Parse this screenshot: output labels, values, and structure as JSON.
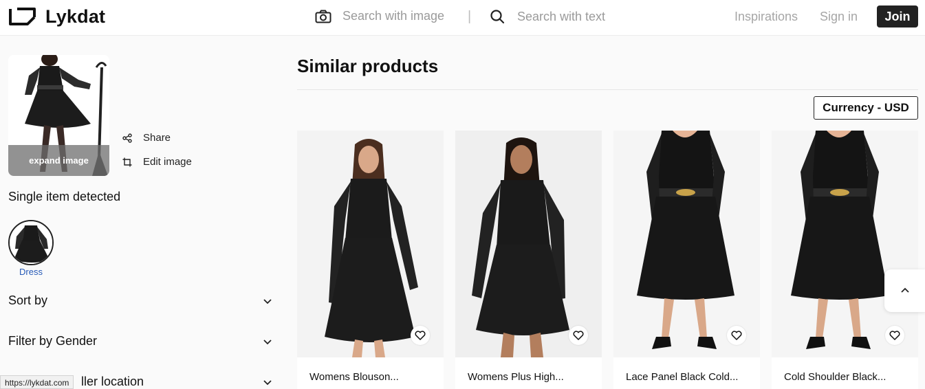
{
  "header": {
    "logo_text": "Lykdat",
    "search_image_placeholder": "Search with image",
    "separator": "|",
    "search_text_placeholder": "Search with text",
    "nav_inspirations": "Inspirations",
    "nav_signin": "Sign in",
    "join_label": "Join"
  },
  "left": {
    "expand_label": "expand image",
    "actions": {
      "share": "Share",
      "edit": "Edit image"
    },
    "detected_label": "Single item detected",
    "items": [
      {
        "label": "Dress"
      }
    ],
    "filters": [
      {
        "label": "Sort by"
      },
      {
        "label": "Filter by Gender"
      },
      {
        "label": "ller location"
      }
    ]
  },
  "main": {
    "title": "Similar products",
    "currency_label": "Currency - USD",
    "products": [
      {
        "title": "Womens Blouson..."
      },
      {
        "title": "Womens Plus High..."
      },
      {
        "title": "Lace Panel Black Cold..."
      },
      {
        "title": "Cold Shoulder Black..."
      }
    ]
  },
  "status": {
    "url": "https://lykdat.com"
  },
  "colors": {
    "accent_dark": "#222222",
    "link_blue": "#2559b7",
    "muted_text": "#9a9a9a"
  }
}
